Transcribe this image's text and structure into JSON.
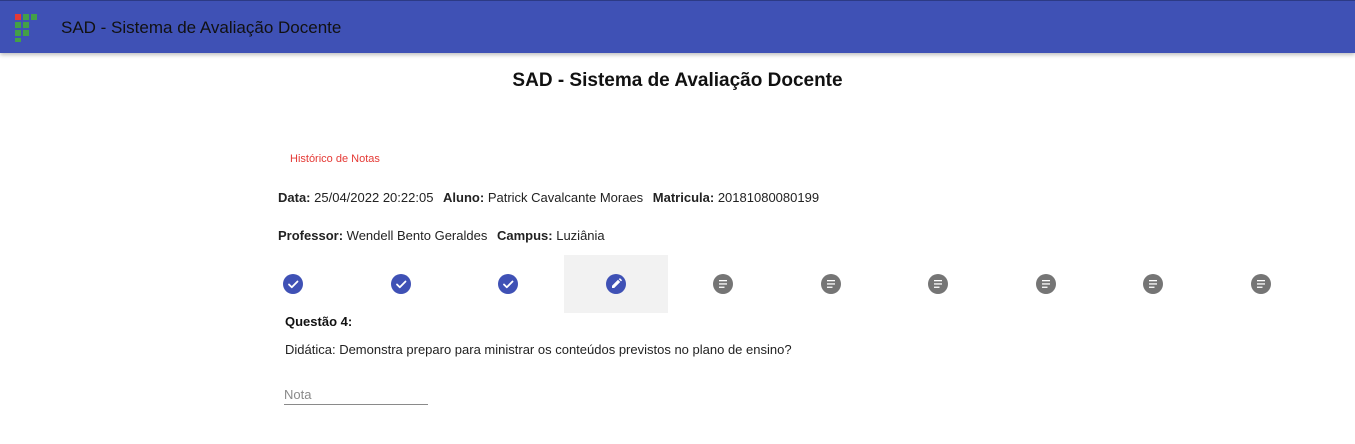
{
  "toolbar": {
    "title": "SAD - Sistema de Avaliação Docente",
    "logo_icon": "ifg-logo-icon",
    "color": "#3f51b5"
  },
  "main": {
    "title": "SAD - Sistema de Avaliação Docente",
    "history_link": "Histórico de Notas"
  },
  "info": {
    "data_label": "Data:",
    "data_value": "25/04/2022 20:22:05",
    "aluno_label": "Aluno:",
    "aluno_value": "Patrick Cavalcante Moraes",
    "matricula_label": "Matricula:",
    "matricula_value": "20181080080199",
    "professor_label": "Professor:",
    "professor_value": "Wendell Bento Geraldes",
    "campus_label": "Campus:",
    "campus_value": "Luziânia"
  },
  "stepper": {
    "steps": [
      {
        "status": "done",
        "icon": "check-icon"
      },
      {
        "status": "done",
        "icon": "check-icon"
      },
      {
        "status": "done",
        "icon": "check-icon"
      },
      {
        "status": "active",
        "icon": "edit-icon"
      },
      {
        "status": "pending",
        "icon": "notes-icon"
      },
      {
        "status": "pending",
        "icon": "notes-icon"
      },
      {
        "status": "pending",
        "icon": "notes-icon"
      },
      {
        "status": "pending",
        "icon": "notes-icon"
      },
      {
        "status": "pending",
        "icon": "notes-icon"
      },
      {
        "status": "pending",
        "icon": "notes-icon"
      }
    ],
    "done_color": "#3f51b5",
    "pending_color": "#757575"
  },
  "question": {
    "label": "Questão 4:",
    "text": "Didática: Demonstra preparo para ministrar os conteúdos previstos no plano de ensino?",
    "nota_placeholder": "Nota",
    "nota_value": ""
  }
}
